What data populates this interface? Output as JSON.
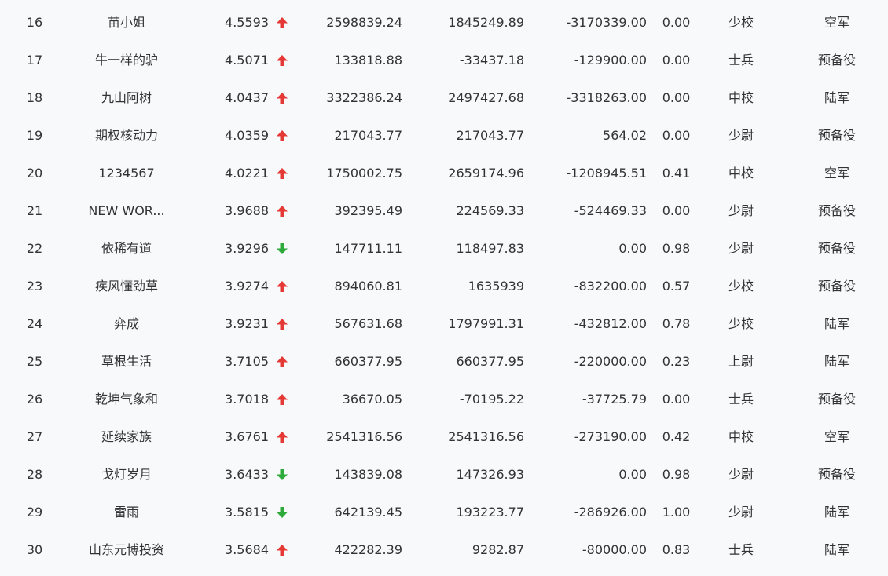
{
  "colors": {
    "up": "#e53935",
    "down": "#2eaa3a"
  },
  "icons": {
    "up": "arrow-up-icon",
    "down": "arrow-down-icon"
  },
  "rows": [
    {
      "rank": "16",
      "name": "苗小姐",
      "score": "4.5593",
      "trend": "up",
      "v1": "2598839.24",
      "v2": "1845249.89",
      "v3": "-3170339.00",
      "rate": "0.00",
      "rank_title": "少校",
      "branch": "空军"
    },
    {
      "rank": "17",
      "name": "牛一样的驴",
      "score": "4.5071",
      "trend": "up",
      "v1": "133818.88",
      "v2": "-33437.18",
      "v3": "-129900.00",
      "rate": "0.00",
      "rank_title": "士兵",
      "branch": "预备役"
    },
    {
      "rank": "18",
      "name": "九山阿树",
      "score": "4.0437",
      "trend": "up",
      "v1": "3322386.24",
      "v2": "2497427.68",
      "v3": "-3318263.00",
      "rate": "0.00",
      "rank_title": "中校",
      "branch": "陆军"
    },
    {
      "rank": "19",
      "name": "期权核动力",
      "score": "4.0359",
      "trend": "up",
      "v1": "217043.77",
      "v2": "217043.77",
      "v3": "564.02",
      "rate": "0.00",
      "rank_title": "少尉",
      "branch": "预备役"
    },
    {
      "rank": "20",
      "name": "1234567",
      "score": "4.0221",
      "trend": "up",
      "v1": "1750002.75",
      "v2": "2659174.96",
      "v3": "-1208945.51",
      "rate": "0.41",
      "rank_title": "中校",
      "branch": "空军"
    },
    {
      "rank": "21",
      "name": "NEW WOR...",
      "score": "3.9688",
      "trend": "up",
      "v1": "392395.49",
      "v2": "224569.33",
      "v3": "-524469.33",
      "rate": "0.00",
      "rank_title": "少尉",
      "branch": "预备役"
    },
    {
      "rank": "22",
      "name": "依稀有道",
      "score": "3.9296",
      "trend": "down",
      "v1": "147711.11",
      "v2": "118497.83",
      "v3": "0.00",
      "rate": "0.98",
      "rank_title": "少尉",
      "branch": "预备役"
    },
    {
      "rank": "23",
      "name": "疾风懂劲草",
      "score": "3.9274",
      "trend": "up",
      "v1": "894060.81",
      "v2": "1635939",
      "v3": "-832200.00",
      "rate": "0.57",
      "rank_title": "少校",
      "branch": "预备役"
    },
    {
      "rank": "24",
      "name": "弈成",
      "score": "3.9231",
      "trend": "up",
      "v1": "567631.68",
      "v2": "1797991.31",
      "v3": "-432812.00",
      "rate": "0.78",
      "rank_title": "少校",
      "branch": "陆军"
    },
    {
      "rank": "25",
      "name": "草根生活",
      "score": "3.7105",
      "trend": "up",
      "v1": "660377.95",
      "v2": "660377.95",
      "v3": "-220000.00",
      "rate": "0.23",
      "rank_title": "上尉",
      "branch": "陆军"
    },
    {
      "rank": "26",
      "name": "乾坤气象和",
      "score": "3.7018",
      "trend": "up",
      "v1": "36670.05",
      "v2": "-70195.22",
      "v3": "-37725.79",
      "rate": "0.00",
      "rank_title": "士兵",
      "branch": "预备役"
    },
    {
      "rank": "27",
      "name": "延续家族",
      "score": "3.6761",
      "trend": "up",
      "v1": "2541316.56",
      "v2": "2541316.56",
      "v3": "-273190.00",
      "rate": "0.42",
      "rank_title": "中校",
      "branch": "空军"
    },
    {
      "rank": "28",
      "name": "戈灯岁月",
      "score": "3.6433",
      "trend": "down",
      "v1": "143839.08",
      "v2": "147326.93",
      "v3": "0.00",
      "rate": "0.98",
      "rank_title": "少尉",
      "branch": "预备役"
    },
    {
      "rank": "29",
      "name": "雷雨",
      "score": "3.5815",
      "trend": "down",
      "v1": "642139.45",
      "v2": "193223.77",
      "v3": "-286926.00",
      "rate": "1.00",
      "rank_title": "少尉",
      "branch": "陆军"
    },
    {
      "rank": "30",
      "name": "山东元博投资",
      "score": "3.5684",
      "trend": "up",
      "v1": "422282.39",
      "v2": "9282.87",
      "v3": "-80000.00",
      "rate": "0.83",
      "rank_title": "士兵",
      "branch": "陆军"
    }
  ]
}
